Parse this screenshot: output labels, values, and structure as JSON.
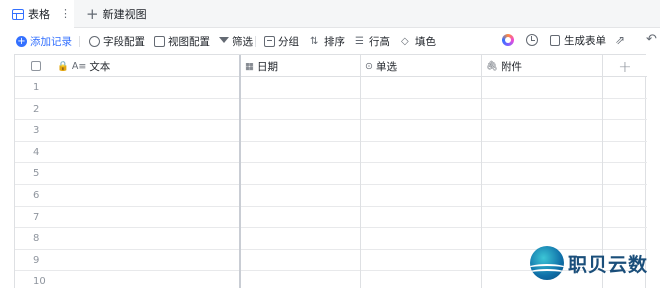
{
  "tabbar": {
    "tab_label": "表格",
    "tab_more": "⋮",
    "new_view_label": "新建视图",
    "new_view_icon": "+"
  },
  "toolbar": {
    "add_record": "添加记录",
    "field_config": "字段配置",
    "view_config": "视图配置",
    "filter": "筛选",
    "group": "分组",
    "sort": "排序",
    "row_height": "行高",
    "fill_color": "填色",
    "generate_form": "生成表单"
  },
  "grid": {
    "columns": [
      {
        "label": "文本",
        "icon": "A≡"
      },
      {
        "label": "日期",
        "icon": "▦"
      },
      {
        "label": "单选",
        "icon": "⊙"
      },
      {
        "label": "附件",
        "icon": "🖇"
      }
    ],
    "add_column": "+",
    "rows": [
      "1",
      "2",
      "3",
      "4",
      "5",
      "6",
      "7",
      "8",
      "9",
      "10"
    ]
  },
  "watermark": {
    "text": "职贝云数"
  },
  "colors": {
    "accent": "#3370ff",
    "border": "#dee0e3",
    "tabbar_bg": "#f5f6f7"
  }
}
